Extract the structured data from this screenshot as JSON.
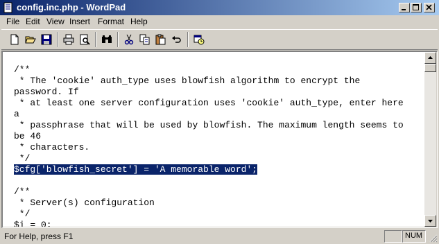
{
  "window": {
    "title": "config.inc.php - WordPad"
  },
  "menu": [
    "File",
    "Edit",
    "View",
    "Insert",
    "Format",
    "Help"
  ],
  "toolbar": {
    "tools": [
      "new-icon",
      "open-icon",
      "save-icon",
      "print-icon",
      "print-preview-icon",
      "find-icon",
      "cut-icon",
      "copy-icon",
      "paste-icon",
      "undo-icon",
      "date-time-icon"
    ]
  },
  "document": {
    "lines_before": [
      "",
      "/**",
      " * The 'cookie' auth_type uses blowfish algorithm to encrypt the",
      "password. If",
      " * at least one server configuration uses 'cookie' auth_type, enter here",
      "a",
      " * passphrase that will be used by blowfish. The maximum length seems to",
      "be 46",
      " * characters.",
      " */"
    ],
    "selected_line": "$cfg['blowfish_secret'] = 'A memorable word';",
    "lines_after": [
      "",
      "/**",
      " * Server(s) configuration",
      " */",
      "$i = 0;"
    ],
    "selection_color": "#0a246a"
  },
  "statusbar": {
    "help_text": "For Help, press F1",
    "num_indicator": "NUM"
  },
  "colors": {
    "title_gradient_start": "#0a246a",
    "title_gradient_end": "#a6caf0",
    "chrome": "#d4d0c8"
  }
}
